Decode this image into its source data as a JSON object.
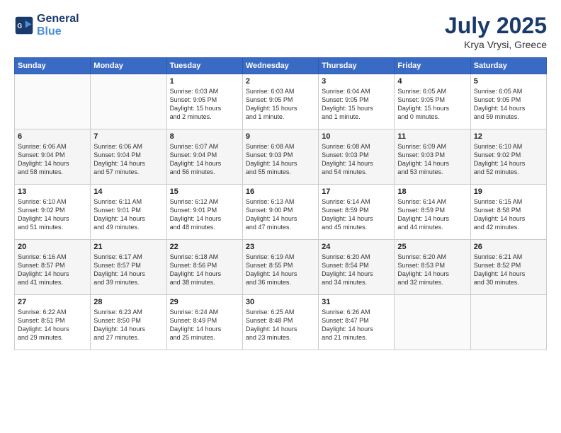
{
  "header": {
    "logo_line1": "General",
    "logo_line2": "Blue",
    "month": "July 2025",
    "location": "Krya Vrysi, Greece"
  },
  "days_of_week": [
    "Sunday",
    "Monday",
    "Tuesday",
    "Wednesday",
    "Thursday",
    "Friday",
    "Saturday"
  ],
  "weeks": [
    [
      {
        "day": "",
        "info": ""
      },
      {
        "day": "",
        "info": ""
      },
      {
        "day": "1",
        "info": "Sunrise: 6:03 AM\nSunset: 9:05 PM\nDaylight: 15 hours\nand 2 minutes."
      },
      {
        "day": "2",
        "info": "Sunrise: 6:03 AM\nSunset: 9:05 PM\nDaylight: 15 hours\nand 1 minute."
      },
      {
        "day": "3",
        "info": "Sunrise: 6:04 AM\nSunset: 9:05 PM\nDaylight: 15 hours\nand 1 minute."
      },
      {
        "day": "4",
        "info": "Sunrise: 6:05 AM\nSunset: 9:05 PM\nDaylight: 15 hours\nand 0 minutes."
      },
      {
        "day": "5",
        "info": "Sunrise: 6:05 AM\nSunset: 9:05 PM\nDaylight: 14 hours\nand 59 minutes."
      }
    ],
    [
      {
        "day": "6",
        "info": "Sunrise: 6:06 AM\nSunset: 9:04 PM\nDaylight: 14 hours\nand 58 minutes."
      },
      {
        "day": "7",
        "info": "Sunrise: 6:06 AM\nSunset: 9:04 PM\nDaylight: 14 hours\nand 57 minutes."
      },
      {
        "day": "8",
        "info": "Sunrise: 6:07 AM\nSunset: 9:04 PM\nDaylight: 14 hours\nand 56 minutes."
      },
      {
        "day": "9",
        "info": "Sunrise: 6:08 AM\nSunset: 9:03 PM\nDaylight: 14 hours\nand 55 minutes."
      },
      {
        "day": "10",
        "info": "Sunrise: 6:08 AM\nSunset: 9:03 PM\nDaylight: 14 hours\nand 54 minutes."
      },
      {
        "day": "11",
        "info": "Sunrise: 6:09 AM\nSunset: 9:03 PM\nDaylight: 14 hours\nand 53 minutes."
      },
      {
        "day": "12",
        "info": "Sunrise: 6:10 AM\nSunset: 9:02 PM\nDaylight: 14 hours\nand 52 minutes."
      }
    ],
    [
      {
        "day": "13",
        "info": "Sunrise: 6:10 AM\nSunset: 9:02 PM\nDaylight: 14 hours\nand 51 minutes."
      },
      {
        "day": "14",
        "info": "Sunrise: 6:11 AM\nSunset: 9:01 PM\nDaylight: 14 hours\nand 49 minutes."
      },
      {
        "day": "15",
        "info": "Sunrise: 6:12 AM\nSunset: 9:01 PM\nDaylight: 14 hours\nand 48 minutes."
      },
      {
        "day": "16",
        "info": "Sunrise: 6:13 AM\nSunset: 9:00 PM\nDaylight: 14 hours\nand 47 minutes."
      },
      {
        "day": "17",
        "info": "Sunrise: 6:14 AM\nSunset: 8:59 PM\nDaylight: 14 hours\nand 45 minutes."
      },
      {
        "day": "18",
        "info": "Sunrise: 6:14 AM\nSunset: 8:59 PM\nDaylight: 14 hours\nand 44 minutes."
      },
      {
        "day": "19",
        "info": "Sunrise: 6:15 AM\nSunset: 8:58 PM\nDaylight: 14 hours\nand 42 minutes."
      }
    ],
    [
      {
        "day": "20",
        "info": "Sunrise: 6:16 AM\nSunset: 8:57 PM\nDaylight: 14 hours\nand 41 minutes."
      },
      {
        "day": "21",
        "info": "Sunrise: 6:17 AM\nSunset: 8:57 PM\nDaylight: 14 hours\nand 39 minutes."
      },
      {
        "day": "22",
        "info": "Sunrise: 6:18 AM\nSunset: 8:56 PM\nDaylight: 14 hours\nand 38 minutes."
      },
      {
        "day": "23",
        "info": "Sunrise: 6:19 AM\nSunset: 8:55 PM\nDaylight: 14 hours\nand 36 minutes."
      },
      {
        "day": "24",
        "info": "Sunrise: 6:20 AM\nSunset: 8:54 PM\nDaylight: 14 hours\nand 34 minutes."
      },
      {
        "day": "25",
        "info": "Sunrise: 6:20 AM\nSunset: 8:53 PM\nDaylight: 14 hours\nand 32 minutes."
      },
      {
        "day": "26",
        "info": "Sunrise: 6:21 AM\nSunset: 8:52 PM\nDaylight: 14 hours\nand 30 minutes."
      }
    ],
    [
      {
        "day": "27",
        "info": "Sunrise: 6:22 AM\nSunset: 8:51 PM\nDaylight: 14 hours\nand 29 minutes."
      },
      {
        "day": "28",
        "info": "Sunrise: 6:23 AM\nSunset: 8:50 PM\nDaylight: 14 hours\nand 27 minutes."
      },
      {
        "day": "29",
        "info": "Sunrise: 6:24 AM\nSunset: 8:49 PM\nDaylight: 14 hours\nand 25 minutes."
      },
      {
        "day": "30",
        "info": "Sunrise: 6:25 AM\nSunset: 8:48 PM\nDaylight: 14 hours\nand 23 minutes."
      },
      {
        "day": "31",
        "info": "Sunrise: 6:26 AM\nSunset: 8:47 PM\nDaylight: 14 hours\nand 21 minutes."
      },
      {
        "day": "",
        "info": ""
      },
      {
        "day": "",
        "info": ""
      }
    ]
  ]
}
